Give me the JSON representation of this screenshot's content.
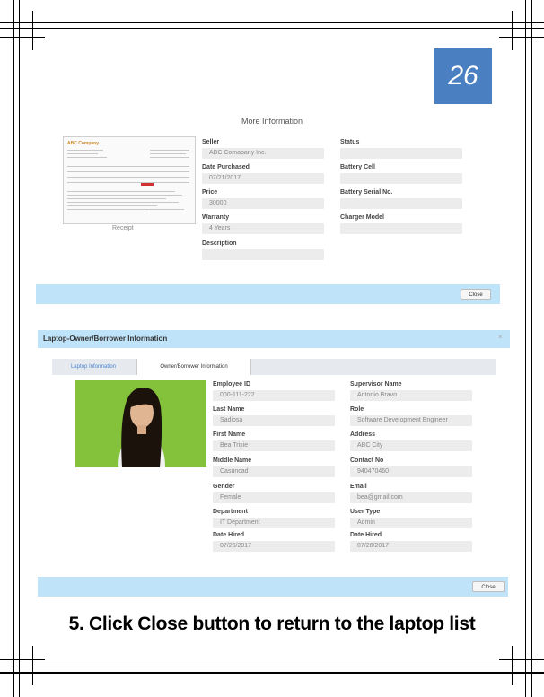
{
  "page_number": "26",
  "more_info": {
    "title": "More Information",
    "receipt_caption": "Receipt",
    "receipt_logo": "ABC Company",
    "fields": [
      {
        "label": "Seller",
        "value": "ABC Comapany Inc."
      },
      {
        "label": "Date Purchased",
        "value": "07/21/2017"
      },
      {
        "label": "Price",
        "value": "30000"
      },
      {
        "label": "Warranty",
        "value": "4 Years"
      },
      {
        "label": "Description",
        "value": ""
      },
      {
        "label": "Status",
        "value": ""
      },
      {
        "label": "Battery Cell",
        "value": ""
      },
      {
        "label": "Battery Serial No.",
        "value": ""
      },
      {
        "label": "Charger Model",
        "value": ""
      }
    ],
    "close_label": "Close"
  },
  "owner_dialog": {
    "title": "Laptop-Owner/Borrower Information",
    "close_x": "×",
    "tabs": [
      {
        "label": "Laptop Information",
        "active": false
      },
      {
        "label": "Owner/Borrower Information",
        "active": true
      }
    ],
    "left_fields": [
      {
        "label": "Employee ID",
        "value": "000-111-222"
      },
      {
        "label": "Last Name",
        "value": "Sadiosa"
      },
      {
        "label": "First Name",
        "value": "Bea Trixie"
      },
      {
        "label": "Middle Name",
        "value": "Casuncad"
      },
      {
        "label": "Gender",
        "value": "Female"
      },
      {
        "label": "Department",
        "value": "IT Department"
      },
      {
        "label": "Date Hired",
        "value": "07/26/2017"
      }
    ],
    "right_fields": [
      {
        "label": "Supervisor Name",
        "value": "Antonio Bravo"
      },
      {
        "label": "Role",
        "value": "Software Development Engineer"
      },
      {
        "label": "Address",
        "value": "ABC City"
      },
      {
        "label": "Contact No",
        "value": "940470460"
      },
      {
        "label": "Email",
        "value": "bea@gmail.com"
      },
      {
        "label": "User Type",
        "value": "Admin"
      },
      {
        "label": "Date Hired",
        "value": "07/26/2017"
      }
    ],
    "close_label": "Close"
  },
  "instruction": "5. Click Close button to return to the laptop list",
  "colors": {
    "accent_bar": "#bfe3f8",
    "page_badge": "#4a7fc1",
    "tab_link": "#4b87d6"
  }
}
